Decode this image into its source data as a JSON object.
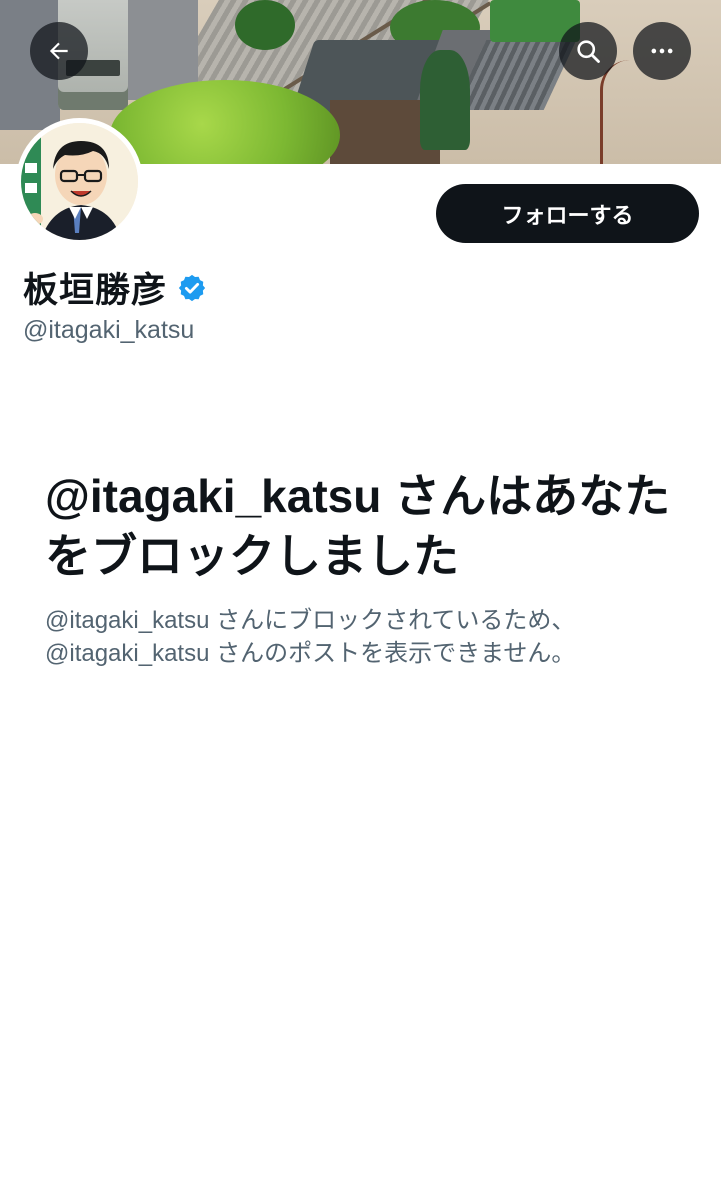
{
  "header": {
    "back_icon": "arrow-left-icon",
    "search_icon": "search-icon",
    "more_icon": "more-horizontal-icon"
  },
  "profile": {
    "display_name": "板垣勝彦",
    "handle": "@itagaki_katsu",
    "verified": true,
    "verified_color": "#1d9bf0",
    "follow_label": "フォローする"
  },
  "blocked": {
    "title": "@itagaki_katsu さんはあなたをブロックしました",
    "description_line1": "@itagaki_katsu さんにブロックされているため、",
    "description_line2": "@itagaki_katsu さんのポストを表示できません。"
  },
  "colors": {
    "text_primary": "#0f1419",
    "text_secondary": "#536471",
    "button_bg": "#0f1419",
    "button_text": "#ffffff"
  }
}
